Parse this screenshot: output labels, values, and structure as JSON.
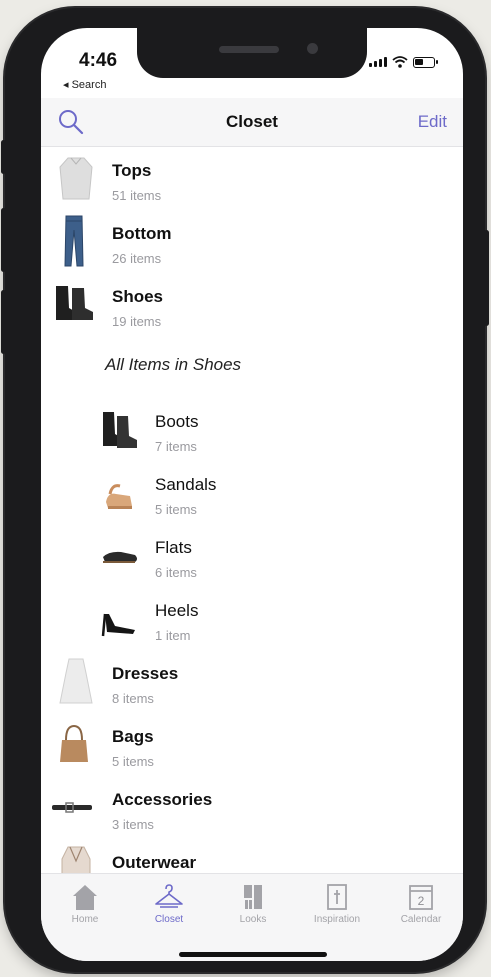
{
  "status": {
    "time": "4:46",
    "back_label": "◂ Search"
  },
  "nav": {
    "title": "Closet",
    "edit_label": "Edit"
  },
  "categories": [
    {
      "label": "Tops",
      "count": "51 items",
      "icon": "top-icon"
    },
    {
      "label": "Bottom",
      "count": "26 items",
      "icon": "jeans-icon"
    },
    {
      "label": "Shoes",
      "count": "19 items",
      "icon": "boot-icon"
    }
  ],
  "section_title": "All Items in Shoes",
  "shoe_subcategories": [
    {
      "label": "Boots",
      "count": "7 items",
      "icon": "boot-icon"
    },
    {
      "label": "Sandals",
      "count": "5 items",
      "icon": "sandal-icon"
    },
    {
      "label": "Flats",
      "count": "6 items",
      "icon": "flat-icon"
    },
    {
      "label": "Heels",
      "count": "1 item",
      "icon": "heel-icon"
    }
  ],
  "more_categories": [
    {
      "label": "Dresses",
      "count": "8 items",
      "icon": "dress-icon"
    },
    {
      "label": "Bags",
      "count": "5 items",
      "icon": "bag-icon"
    },
    {
      "label": "Accessories",
      "count": "3 items",
      "icon": "belt-icon"
    },
    {
      "label": "Outerwear",
      "count": "",
      "icon": "coat-icon"
    }
  ],
  "tabs": [
    {
      "label": "Home",
      "icon": "house-icon",
      "active": false
    },
    {
      "label": "Closet",
      "icon": "hanger-icon",
      "active": true
    },
    {
      "label": "Looks",
      "icon": "outfit-icon",
      "active": false
    },
    {
      "label": "Inspiration",
      "icon": "inspiration-icon",
      "active": false
    },
    {
      "label": "Calendar",
      "icon": "calendar-icon",
      "active": false,
      "calendar_day": "2"
    }
  ],
  "colors": {
    "accent": "#6d6ac9",
    "subtitle": "#9a9a9f",
    "tab_inactive": "#a3a3a8"
  }
}
